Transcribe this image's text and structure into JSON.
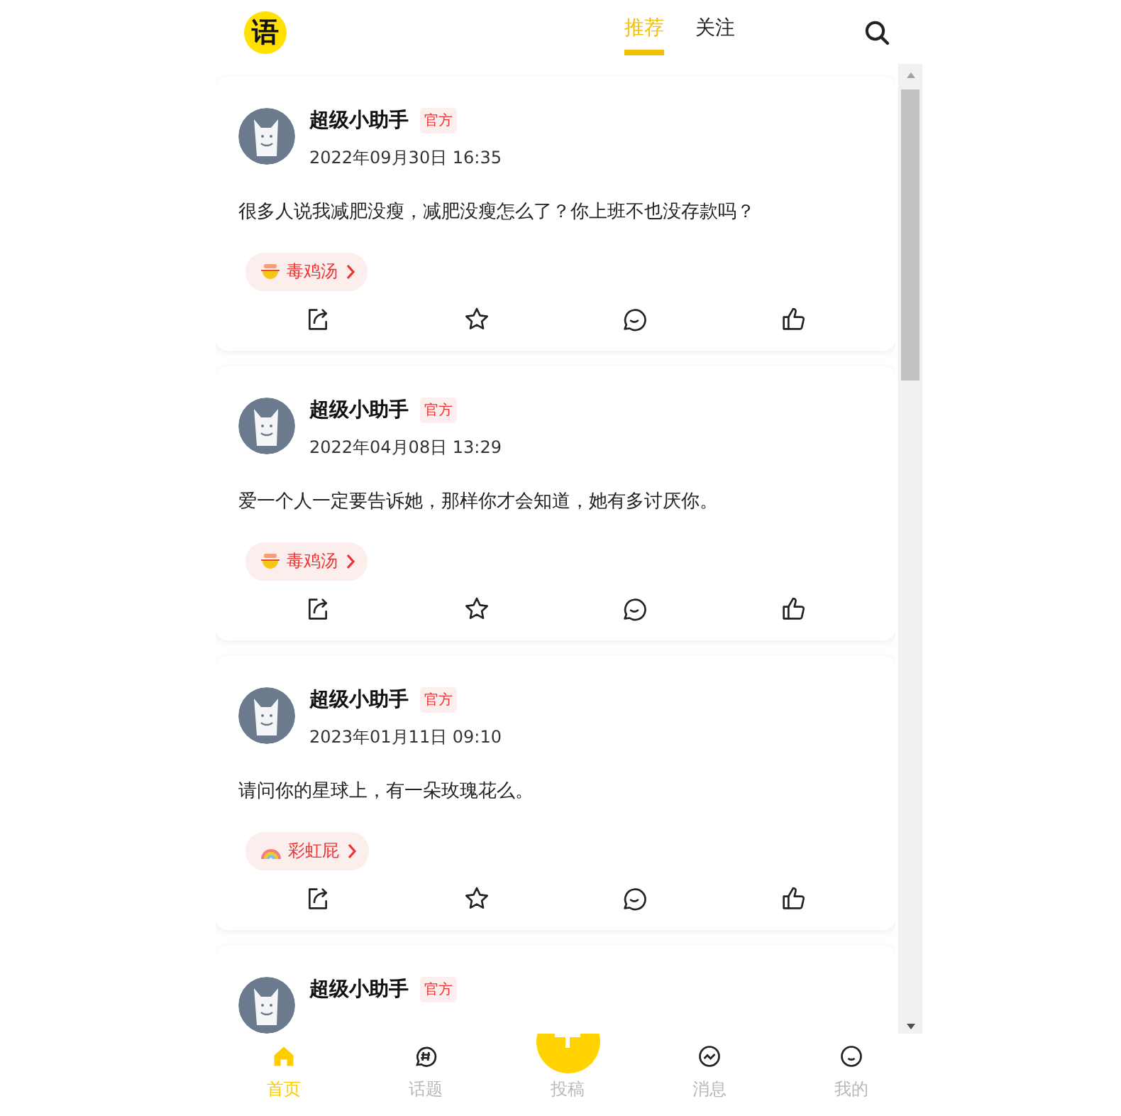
{
  "header": {
    "logo": "语",
    "tabs": [
      {
        "label": "推荐",
        "selected": true
      },
      {
        "label": "关注",
        "selected": false
      }
    ]
  },
  "posts": [
    {
      "author": "超级小助手",
      "badge": "官方",
      "date": "2022年09月30日 16:35",
      "text": "很多人说我减肥没瘦，减肥没瘦怎么了？你上班不也没存款吗？",
      "topic": {
        "kind": "soup",
        "label": "毒鸡汤"
      }
    },
    {
      "author": "超级小助手",
      "badge": "官方",
      "date": "2022年04月08日 13:29",
      "text": "爱一个人一定要告诉她，那样你才会知道，她有多讨厌你。",
      "topic": {
        "kind": "soup",
        "label": "毒鸡汤"
      }
    },
    {
      "author": "超级小助手",
      "badge": "官方",
      "date": "2023年01月11日 09:10",
      "text": "请问你的星球上，有一朵玫瑰花么。",
      "topic": {
        "kind": "rainbow",
        "label": "彩虹屁"
      }
    },
    {
      "author": "超级小助手",
      "badge": "官方"
    }
  ],
  "nav": [
    {
      "kind": "home",
      "label": "首页",
      "selected": true
    },
    {
      "kind": "topic",
      "label": "话题",
      "selected": false
    },
    {
      "kind": "post",
      "label": "投稿",
      "selected": false
    },
    {
      "kind": "message",
      "label": "消息",
      "selected": false
    },
    {
      "kind": "me",
      "label": "我的",
      "selected": false
    }
  ]
}
